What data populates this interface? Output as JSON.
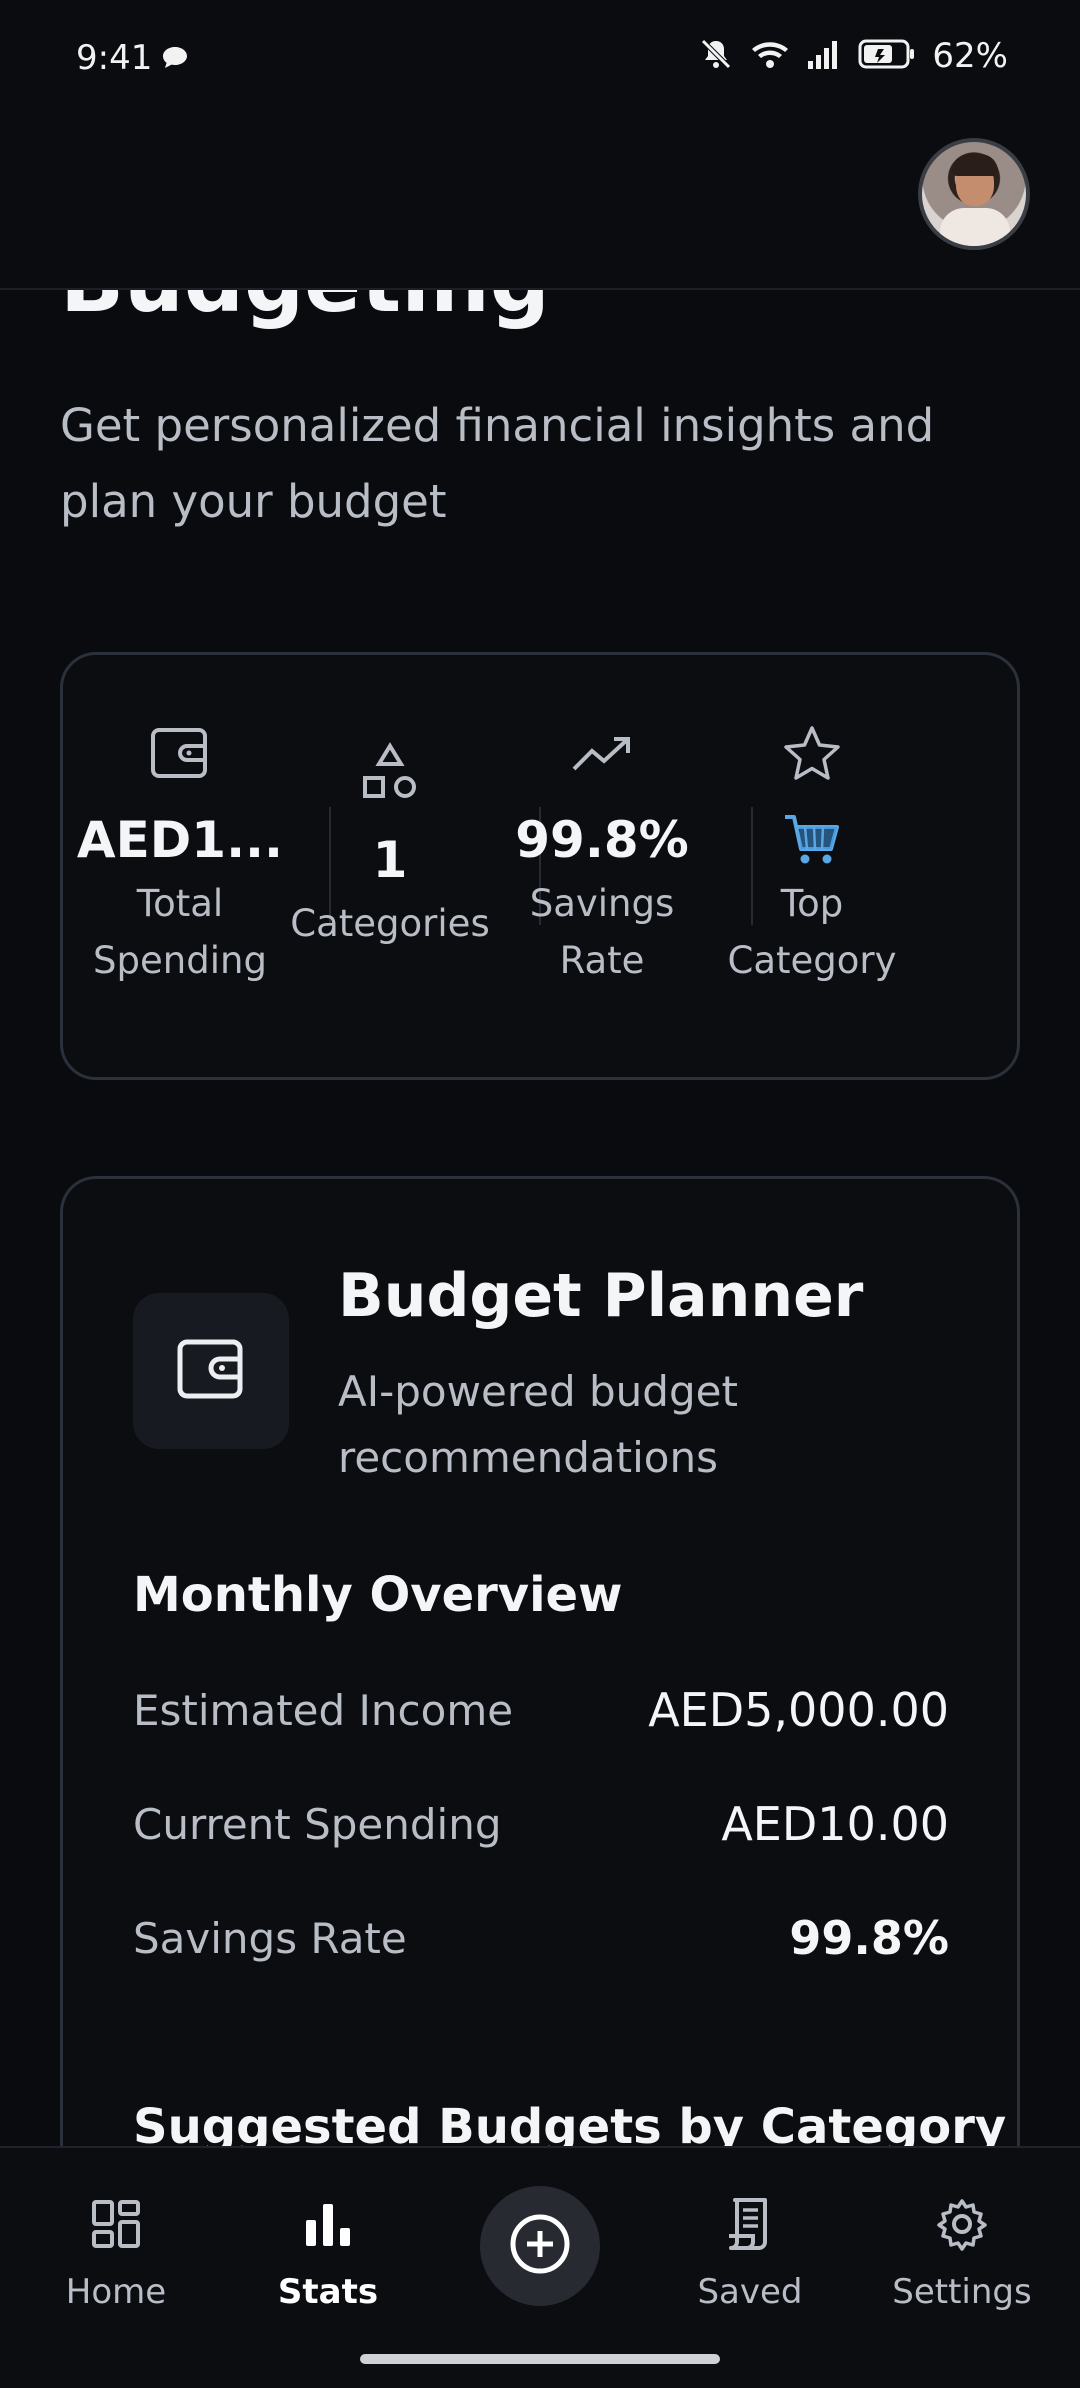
{
  "status_bar": {
    "time": "9:41",
    "battery": "62%"
  },
  "header": {
    "title": "Budgeting",
    "subtitle": "Get personalized financial insights and plan your budget"
  },
  "stats": [
    {
      "icon": "wallet-icon",
      "value": "AED1...",
      "label": "Total Spending"
    },
    {
      "icon": "shapes-icon",
      "value": "1",
      "label": "Categories"
    },
    {
      "icon": "trending-up-icon",
      "value": "99.8%",
      "label": "Savings Rate"
    },
    {
      "icon": "star-icon",
      "value_icon": "shopping-cart-icon",
      "label": "Top Category"
    }
  ],
  "planner": {
    "title": "Budget Planner",
    "subtitle": "AI-powered budget recommendations",
    "overview_title": "Monthly Overview",
    "rows": [
      {
        "label": "Estimated Income",
        "value": "AED5,000.00"
      },
      {
        "label": "Current Spending",
        "value": "AED10.00"
      },
      {
        "label": "Savings Rate",
        "value": "99.8%"
      }
    ],
    "suggested_title": "Suggested Budgets by Category"
  },
  "nav": {
    "home": "Home",
    "stats": "Stats",
    "saved": "Saved",
    "settings": "Settings",
    "active": "Stats"
  },
  "colors": {
    "background": "#090b0f",
    "card_border": "#2b313a",
    "text_primary": "#f4f5f7",
    "text_secondary": "#b9bdc6"
  }
}
